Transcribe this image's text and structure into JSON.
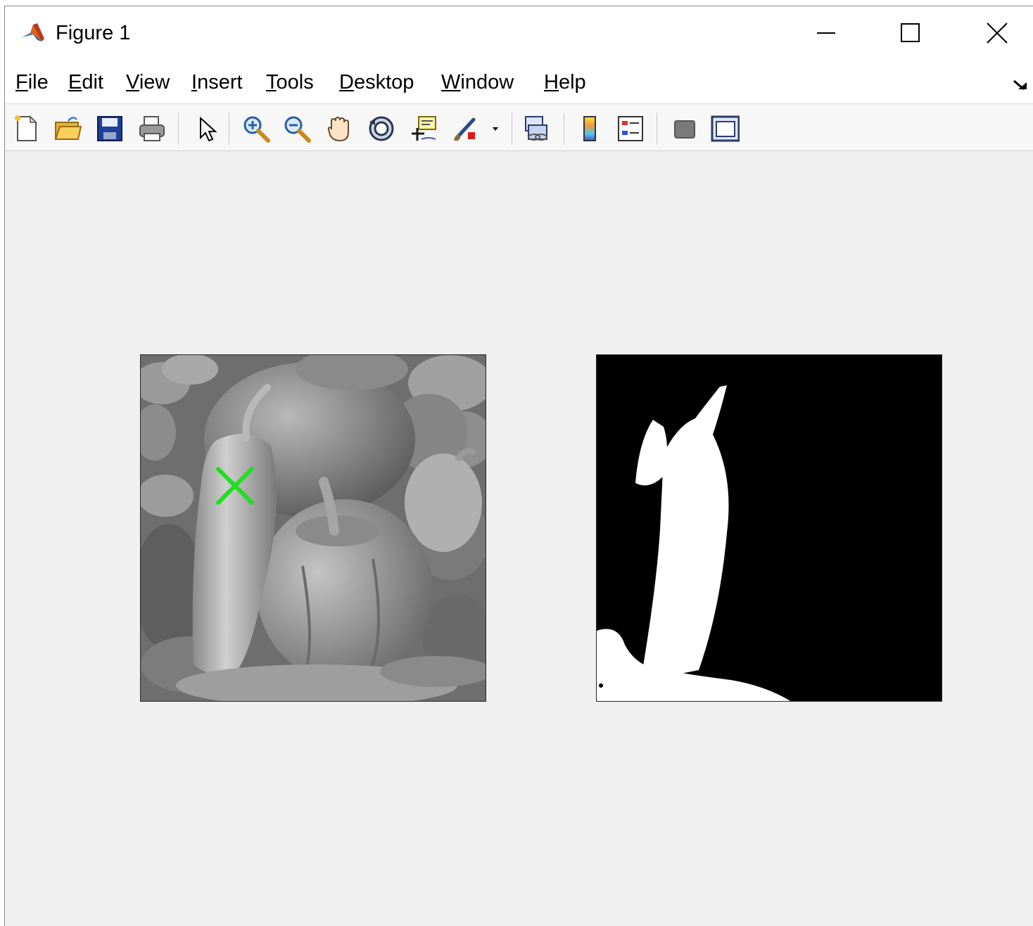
{
  "window": {
    "title": "Figure 1",
    "icon": "matlab-logo-icon"
  },
  "window_controls": {
    "minimize": "minimize-icon",
    "maximize": "maximize-icon",
    "close": "close-icon"
  },
  "menu": {
    "items": [
      {
        "first": "F",
        "rest": "ile"
      },
      {
        "first": "E",
        "rest": "dit"
      },
      {
        "first": "V",
        "rest": "iew"
      },
      {
        "first": "I",
        "rest": "nsert"
      },
      {
        "first": "T",
        "rest": "ools"
      },
      {
        "first": "D",
        "rest": "esktop"
      },
      {
        "first": "W",
        "rest": "indow"
      },
      {
        "first": "H",
        "rest": "elp"
      }
    ],
    "dock_icon": "dock-figure-icon"
  },
  "toolbar": {
    "icons": [
      "new-figure-icon",
      "open-file-icon",
      "save-icon",
      "print-icon",
      "edit-plot-pointer-icon",
      "zoom-in-icon",
      "zoom-out-icon",
      "pan-hand-icon",
      "rotate-3d-icon",
      "data-cursor-icon",
      "brush-icon",
      "brush-dropdown-icon",
      "link-plot-icon",
      "insert-colorbar-icon",
      "insert-legend-icon",
      "hide-plot-tools-icon",
      "show-plot-tools-icon"
    ]
  },
  "figure": {
    "axes": [
      {
        "content": "grayscale peppers image",
        "marker": {
          "symbol": "x",
          "color": "#22dd22"
        }
      },
      {
        "content": "binary segmentation mask"
      }
    ]
  },
  "colors": {
    "canvas": "#f0f0f0",
    "toolbar": "#f7f7f7",
    "marker": "#22dd22"
  }
}
